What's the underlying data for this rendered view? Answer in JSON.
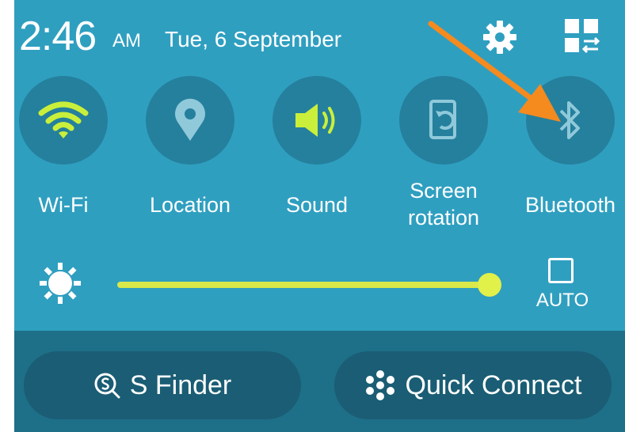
{
  "status_bar": {
    "time": "2:46",
    "ampm": "AM",
    "date": "Tue, 6 September",
    "settings_icon": "gear-icon",
    "quick_panel_icon": "grid-edit-icon"
  },
  "toggles": [
    {
      "label": "Wi-Fi",
      "icon": "wifi-icon",
      "state": "on"
    },
    {
      "label": "Location",
      "icon": "location-pin-icon",
      "state": "off"
    },
    {
      "label": "Sound",
      "icon": "speaker-icon",
      "state": "on"
    },
    {
      "label_line1": "Screen",
      "label_line2": "rotation",
      "icon": "rotation-icon",
      "state": "off"
    },
    {
      "label": "Bluetooth",
      "icon": "bluetooth-icon",
      "state": "off"
    }
  ],
  "brightness": {
    "icon": "brightness-sun-icon",
    "level_fraction": 0.98,
    "auto_label": "AUTO",
    "auto_checked": false
  },
  "bottom_buttons": {
    "s_finder": {
      "label": "S Finder",
      "icon": "search-s-icon"
    },
    "quick_connect": {
      "label": "Quick Connect",
      "icon": "quick-connect-icon"
    }
  },
  "colors": {
    "panel": "#2f9fc0",
    "toggle_bg": "#25809d",
    "active": "#c9ef3a",
    "inactive_icon": "#8fc9da",
    "slider": "#d9e84a",
    "arrow": "#f58a1f"
  }
}
